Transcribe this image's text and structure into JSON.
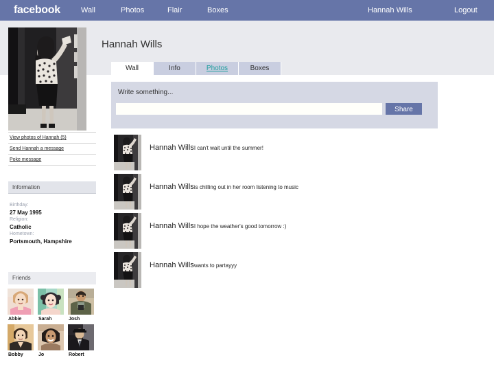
{
  "topbar": {
    "logo": "facebook",
    "nav": [
      {
        "name": "wall",
        "label": "Wall"
      },
      {
        "name": "photos",
        "label": "Photos"
      },
      {
        "name": "flair",
        "label": "Flair"
      },
      {
        "name": "boxes",
        "label": "Boxes"
      }
    ],
    "user": "Hannah Wills",
    "logout": "Logout",
    "bg_color": "#6675a8"
  },
  "profile": {
    "name": "Hannah Wills",
    "photo_alt": "hannah-profile-photo"
  },
  "tabs": [
    {
      "name": "wall",
      "label": "Wall",
      "state": "active"
    },
    {
      "name": "info",
      "label": "Info",
      "state": "normal"
    },
    {
      "name": "photos",
      "label": "Photos",
      "state": "link"
    },
    {
      "name": "boxes",
      "label": "Boxes",
      "state": "normal"
    }
  ],
  "publisher": {
    "label": "Write something...",
    "value": "",
    "placeholder": "",
    "share_label": "Share"
  },
  "sidebar": {
    "links": [
      {
        "name": "view-photos",
        "label": "View photos of Hannah (5)"
      },
      {
        "name": "send-message",
        "label": "Send Hannah a message"
      },
      {
        "name": "poke-message",
        "label": "Poke message"
      }
    ],
    "information_header": "Information",
    "information": [
      {
        "key": "Birthday:",
        "value": "27 May 1995"
      },
      {
        "key": "Religion:",
        "value": "Catholic"
      },
      {
        "key": "Hometown:",
        "value": "Portsmouth, Hampshire"
      }
    ],
    "friends_header": "Friends",
    "friends": [
      {
        "name": "Abbie",
        "c1": "#f2d3c0",
        "c2": "#c98a6a",
        "c3": "#e8a0b0"
      },
      {
        "name": "Sarah",
        "c1": "#f3dccb",
        "c2": "#3a3a44",
        "c3": "#9fd6c8"
      },
      {
        "name": "Josh",
        "c1": "#d8c7a8",
        "c2": "#5d6348",
        "c3": "#8d9a8a"
      },
      {
        "name": "Bobby",
        "c1": "#e8cdb0",
        "c2": "#2f2a26",
        "c3": "#c9a06a"
      },
      {
        "name": "Jo",
        "c1": "#e3bb96",
        "c2": "#2b2320",
        "c3": "#d9c2a8"
      },
      {
        "name": "Robert",
        "c1": "#dcc9b4",
        "c2": "#1e1c1f",
        "c3": "#6d6a70"
      }
    ]
  },
  "feed": {
    "posts": [
      {
        "author": "Hannah Wills",
        "text": "I can't wait until the summer!"
      },
      {
        "author": "Hannah Wills",
        "text": "is chilling out in her room listening to music"
      },
      {
        "author": "Hannah Wills",
        "text": "I hope the weather's good tomorrow :)"
      },
      {
        "author": "Hannah Wills",
        "text": "wants to partayyy"
      }
    ]
  }
}
